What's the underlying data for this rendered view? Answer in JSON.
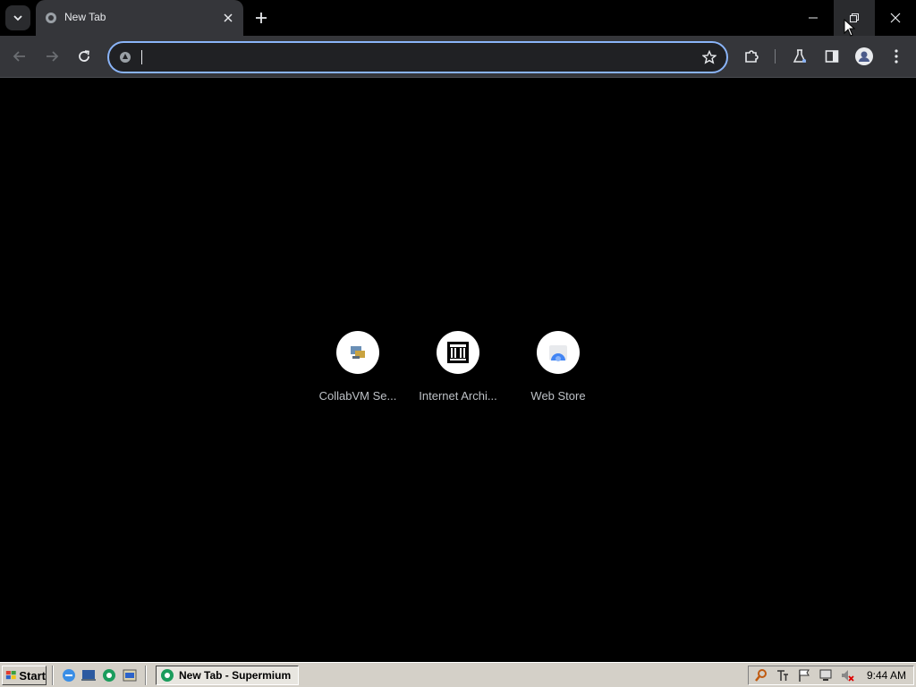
{
  "browser": {
    "tab": {
      "title": "New Tab"
    },
    "omnibox": {
      "value": "",
      "placeholder": ""
    }
  },
  "shortcuts": [
    {
      "label": "CollabVM Se...",
      "icon": "collabvm-icon"
    },
    {
      "label": "Internet Archi...",
      "icon": "internet-archive-icon"
    },
    {
      "label": "Web Store",
      "icon": "web-store-icon"
    }
  ],
  "taskbar": {
    "start_label": "Start",
    "task_label": "New Tab - Supermium",
    "clock": "9:44 AM"
  },
  "colors": {
    "accent": "#8ab4f8",
    "toolbar": "#35363a",
    "page_bg": "#000000",
    "taskbar": "#d4d0c8"
  }
}
